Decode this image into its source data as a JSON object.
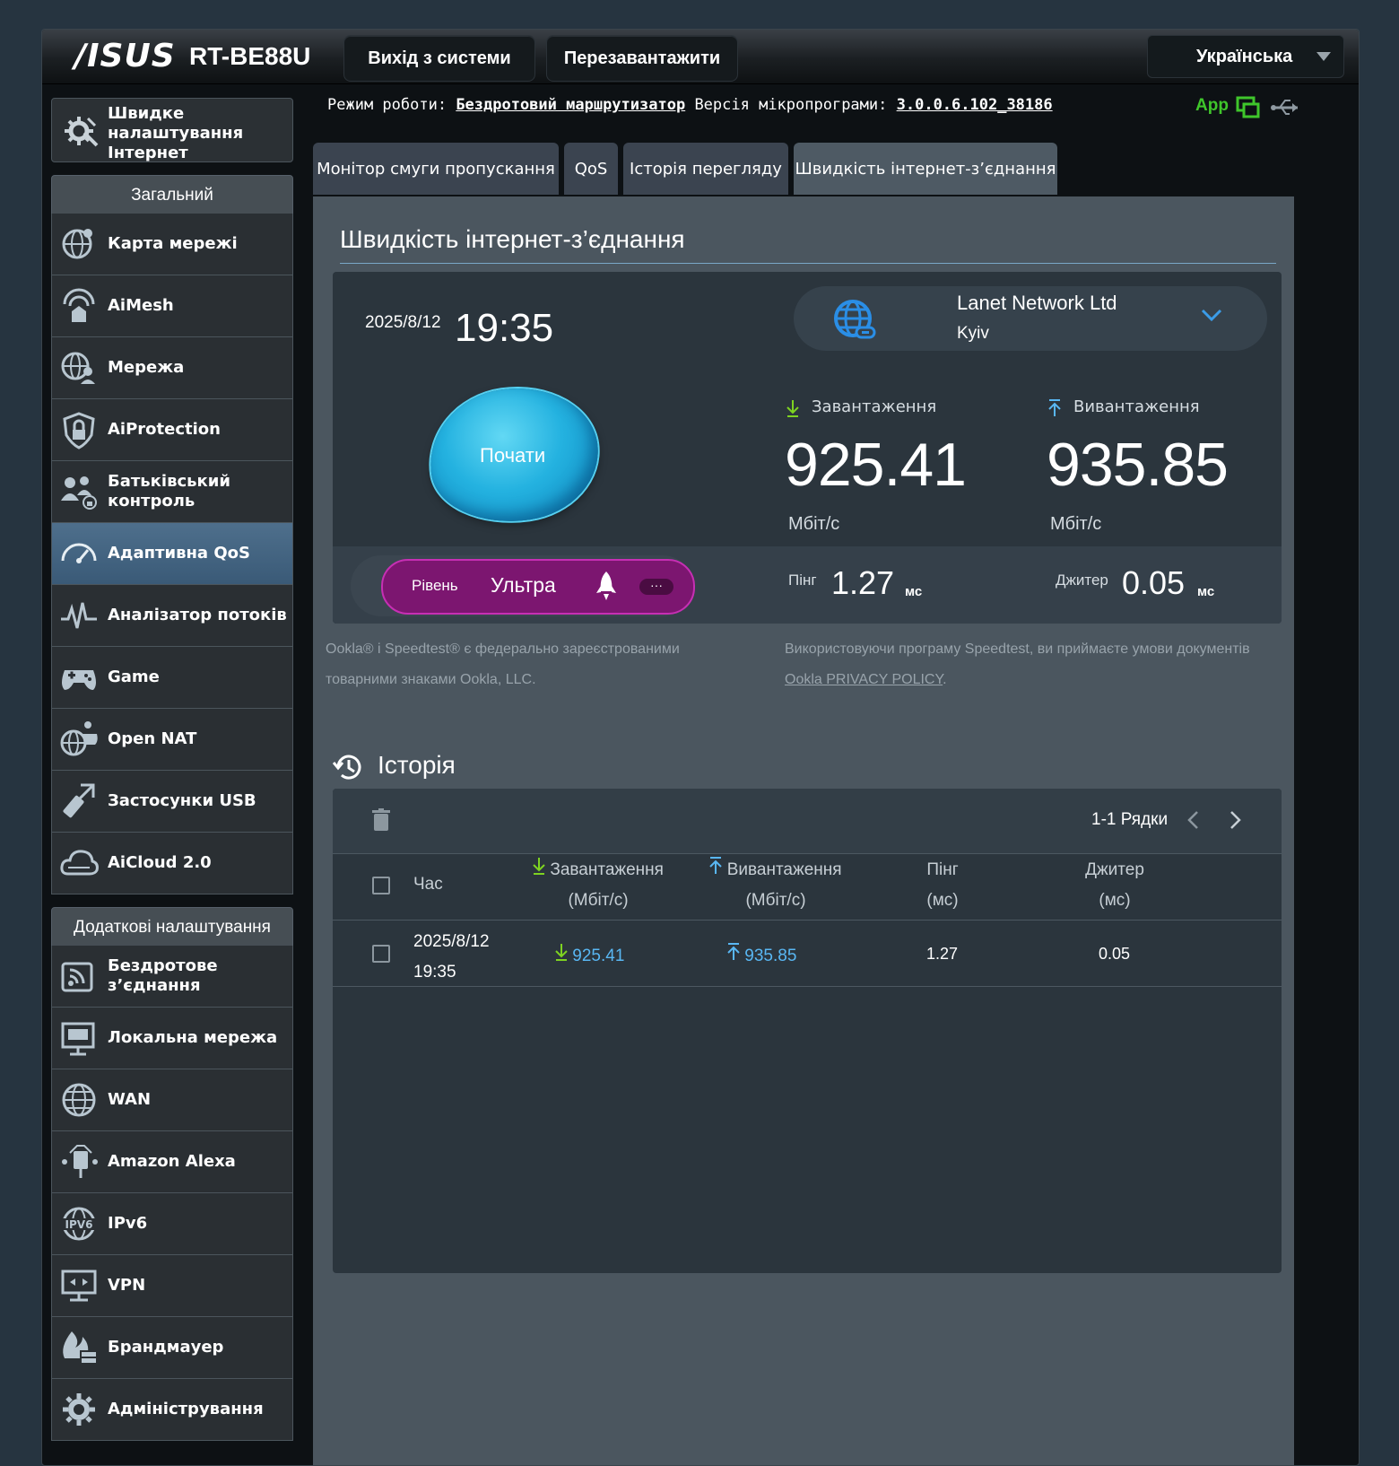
{
  "header": {
    "brand": "/ISUS",
    "model": "RT-BE88U",
    "logout_label": "Вихід з системи",
    "reboot_label": "Перезавантажити",
    "language": "Українська"
  },
  "status": {
    "mode_label": "Режим роботи:",
    "mode_value": "Бездротовий маршрутизатор",
    "fw_label": "Версія мікропрограми:",
    "fw_value": "3.0.0.6.102_38186",
    "app_label": "App"
  },
  "sidebar": {
    "quick_setup": "Швидке налаштування Інтернет",
    "general_header": "Загальний",
    "general_items": [
      {
        "label": "Карта мережі",
        "icon": "network-map-icon"
      },
      {
        "label": "AiMesh",
        "icon": "aimesh-icon"
      },
      {
        "label": "Мережа",
        "icon": "guest-network-icon"
      },
      {
        "label": "AiProtection",
        "icon": "aiprotection-icon"
      },
      {
        "label": "Батьківський контроль",
        "icon": "parental-control-icon"
      },
      {
        "label": "Адаптивна QoS",
        "icon": "qos-gauge-icon"
      },
      {
        "label": "Аналізатор потоків",
        "icon": "traffic-analyzer-icon"
      },
      {
        "label": "Game",
        "icon": "gamepad-icon"
      },
      {
        "label": "Open NAT",
        "icon": "open-nat-icon"
      },
      {
        "label": "Застосунки USB",
        "icon": "usb-icon"
      },
      {
        "label": "AiCloud 2.0",
        "icon": "cloud-icon"
      }
    ],
    "advanced_header": "Додаткові налаштування",
    "advanced_items": [
      {
        "label": "Бездротове з’єднання",
        "icon": "wireless-icon"
      },
      {
        "label": "Локальна мережа",
        "icon": "lan-icon"
      },
      {
        "label": "WAN",
        "icon": "globe-icon"
      },
      {
        "label": "Amazon Alexa",
        "icon": "alexa-icon"
      },
      {
        "label": "IPv6",
        "icon": "ipv6-icon"
      },
      {
        "label": "VPN",
        "icon": "vpn-icon"
      },
      {
        "label": "Брандмауер",
        "icon": "firewall-icon"
      },
      {
        "label": "Адміністрування",
        "icon": "gear-icon"
      }
    ]
  },
  "tabs": [
    {
      "label": "Монітор смуги пропускання"
    },
    {
      "label": "QoS"
    },
    {
      "label": "Історія перегляду"
    },
    {
      "label": "Швидкість інтернет-з’єднання"
    }
  ],
  "speedtest": {
    "title": "Швидкість інтернет-з’єднання",
    "date": "2025/8/12",
    "time": "19:35",
    "server_name": "Lanet Network Ltd",
    "server_city": "Kyiv",
    "start_label": "Почати",
    "download_label": "Завантаження",
    "upload_label": "Вивантаження",
    "download_value": "925.41",
    "upload_value": "935.85",
    "unit": "Мбіт/с",
    "level_label": "Рівень",
    "level_value": "Ультра",
    "level_more": "···",
    "ping_label": "Пінг",
    "ping_value": "1.27",
    "jitter_label": "Джитер",
    "jitter_value": "0.05",
    "ms_unit": "мс",
    "trademark_line1": "Ookla® і Speedtest® є федерально зареєстрованими",
    "trademark_line2": "товарними знаками Ookla, LLC.",
    "terms_line": "Використовуючи програму Speedtest, ви приймаєте умови документів",
    "privacy_link": "Ookla PRIVACY POLICY",
    "privacy_dot": "."
  },
  "history": {
    "title": "Історія",
    "rows_label": "1-1 Рядки",
    "columns": {
      "time": "Час",
      "download": "Завантаження",
      "download_unit": "(Мбіт/с)",
      "upload": "Вивантаження",
      "upload_unit": "(Мбіт/с)",
      "ping": "Пінг",
      "ping_unit": "(мс)",
      "jitter": "Джитер",
      "jitter_unit": "(мс)"
    },
    "rows": [
      {
        "date": "2025/8/12",
        "time": "19:35",
        "download": "925.41",
        "upload": "935.85",
        "ping": "1.27",
        "jitter": "0.05"
      }
    ]
  }
}
